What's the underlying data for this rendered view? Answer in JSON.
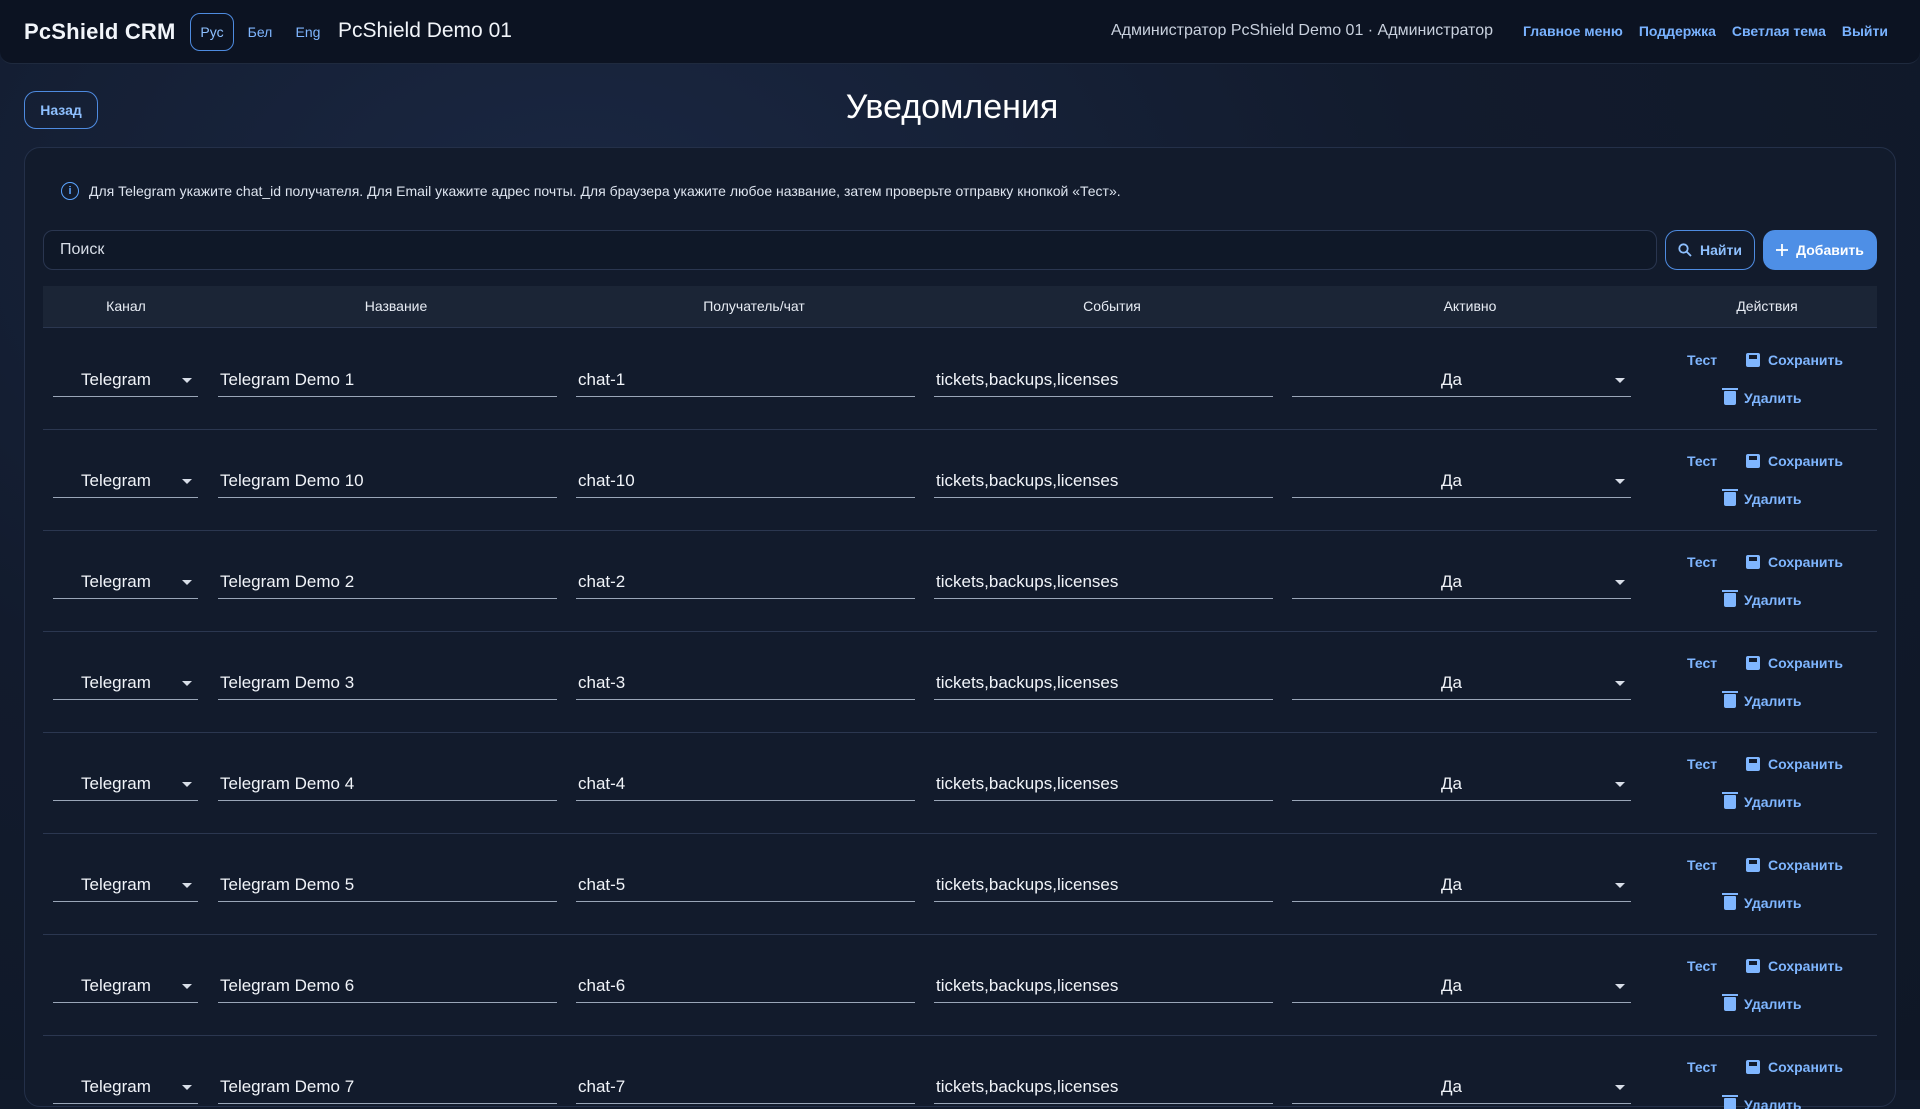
{
  "header": {
    "brand": "PcShield CRM",
    "languages": [
      {
        "label": "Рус",
        "active": true
      },
      {
        "label": "Бел",
        "active": false
      },
      {
        "label": "Eng",
        "active": false
      }
    ],
    "organization": "PcShield Demo 01",
    "user": "Администратор PcShield Demo 01 · Администратор",
    "nav": [
      "Главное меню",
      "Поддержка",
      "Светлая тема",
      "Выйти"
    ]
  },
  "page": {
    "back_label": "Назад",
    "title": "Уведомления"
  },
  "info_text": "Для Telegram укажите chat_id получателя. Для Email укажите адрес почты. Для браузера укажите любое название, затем проверьте отправку кнопкой «Тест».",
  "toolbar": {
    "search_placeholder": "Поиск",
    "find_label": "Найти",
    "add_label": "Добавить"
  },
  "table": {
    "columns": [
      "Канал",
      "Название",
      "Получатель/чат",
      "События",
      "Активно",
      "Действия"
    ],
    "action_labels": {
      "test": "Тест",
      "save": "Сохранить",
      "delete": "Удалить"
    },
    "rows": [
      {
        "channel": "Telegram",
        "name": "Telegram Demo 1",
        "recipient": "chat-1",
        "events": "tickets,backups,licenses",
        "active": "Да"
      },
      {
        "channel": "Telegram",
        "name": "Telegram Demo 10",
        "recipient": "chat-10",
        "events": "tickets,backups,licenses",
        "active": "Да"
      },
      {
        "channel": "Telegram",
        "name": "Telegram Demo 2",
        "recipient": "chat-2",
        "events": "tickets,backups,licenses",
        "active": "Да"
      },
      {
        "channel": "Telegram",
        "name": "Telegram Demo 3",
        "recipient": "chat-3",
        "events": "tickets,backups,licenses",
        "active": "Да"
      },
      {
        "channel": "Telegram",
        "name": "Telegram Demo 4",
        "recipient": "chat-4",
        "events": "tickets,backups,licenses",
        "active": "Да"
      },
      {
        "channel": "Telegram",
        "name": "Telegram Demo 5",
        "recipient": "chat-5",
        "events": "tickets,backups,licenses",
        "active": "Да"
      },
      {
        "channel": "Telegram",
        "name": "Telegram Demo 6",
        "recipient": "chat-6",
        "events": "tickets,backups,licenses",
        "active": "Да"
      },
      {
        "channel": "Telegram",
        "name": "Telegram Demo 7",
        "recipient": "chat-7",
        "events": "tickets,backups,licenses",
        "active": "Да"
      }
    ]
  },
  "colors": {
    "background": "#111a2b",
    "accent": "#4e8fe6",
    "link": "#7fb6ff"
  }
}
